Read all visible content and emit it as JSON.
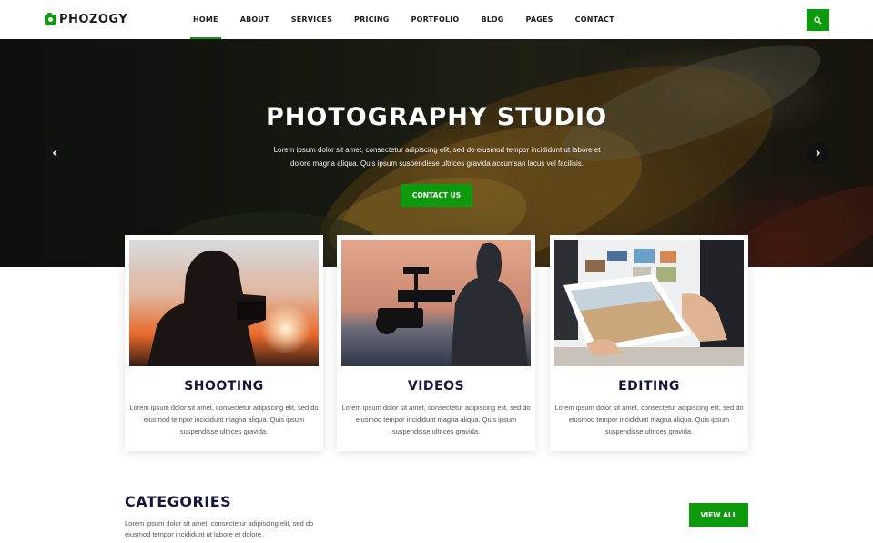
{
  "brand": {
    "name": "PHOZOGY",
    "accent": "#0d9b0d",
    "icon": "camera-icon"
  },
  "nav": {
    "items": [
      "HOME",
      "ABOUT",
      "SERVICES",
      "PRICING",
      "PORTFOLIO",
      "BLOG",
      "PAGES",
      "CONTACT"
    ],
    "active": "HOME",
    "search_icon": "search-icon"
  },
  "hero": {
    "title": "PHOTOGRAPHY STUDIO",
    "text": "Lorem ipsum dolor sit amet, consectetur adipiscing elit, sed do eiusmod tempor incididunt ut labore et dolore magna aliqua. Quis ipsum suspendisse ultrices gravida accumsan lacus vel facilisis.",
    "button": "CONTACT US",
    "prev_icon": "chevron-left-icon",
    "next_icon": "chevron-right-icon"
  },
  "services": [
    {
      "title": "SHOOTING",
      "text": "Lorem ipsum dolor sit amet, consectetur adipiscing elit, sed do eiusmod tempor incididunt magna aliqua. Quis ipsum suspendisse ultrices gravida."
    },
    {
      "title": "VIDEOS",
      "text": "Lorem ipsum dolor sit amet, consectetur adipiscing elit, sed do eiusmod tempor incididunt magna aliqua. Quis ipsum suspendisse ultrices gravida."
    },
    {
      "title": "EDITING",
      "text": "Lorem ipsum dolor sit amet, consectetur adipiscing elit, sed do eiusmod tempor incididunt magna aliqua. Quis ipsum suspendisse ultrices gravida."
    }
  ],
  "categories": {
    "title": "CATEGORIES",
    "text": "Lorem ipsum dolor sit amet, consectetur adipiscing elit, sed do eiusmod tempor incididunt ut labore et dolore.",
    "button": "VIEW ALL"
  }
}
